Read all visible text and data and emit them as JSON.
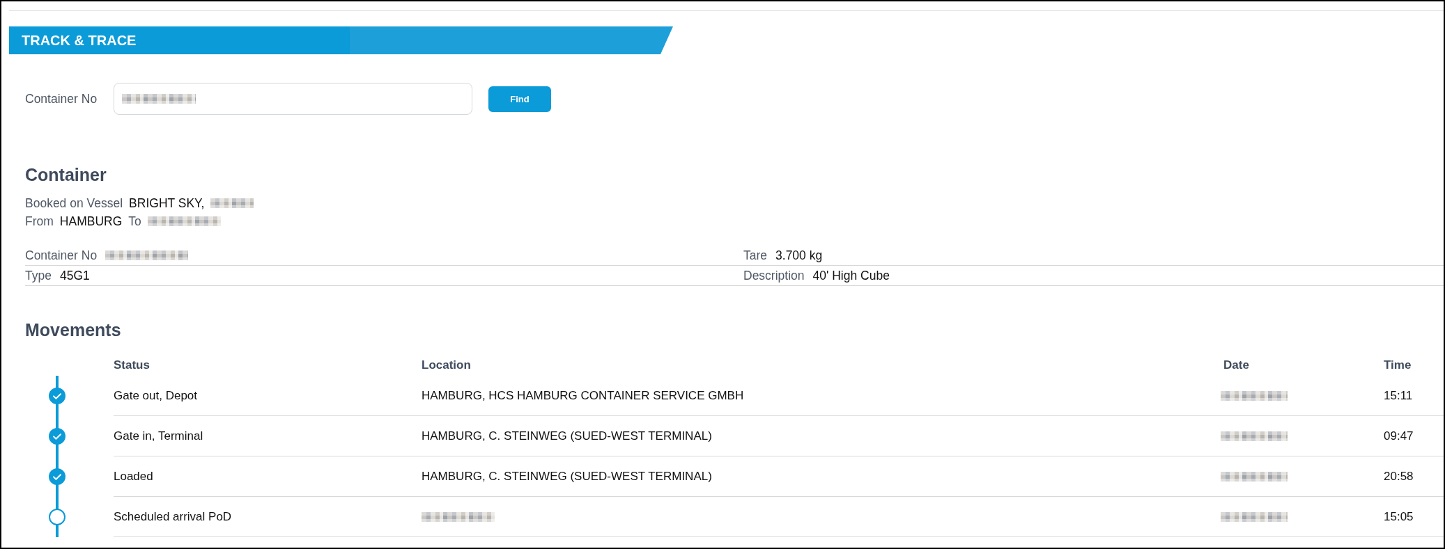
{
  "banner": {
    "title": "TRACK & TRACE"
  },
  "search": {
    "label": "Container No",
    "value_redacted": true,
    "button": "Find"
  },
  "container": {
    "heading": "Container",
    "lines": [
      {
        "fields": [
          {
            "label": "Booked on Vessel",
            "value": "BRIGHT SKY,",
            "redacted": true
          }
        ]
      },
      {
        "fields": [
          {
            "label": "From",
            "value": "HAMBURG",
            "redacted": false
          },
          {
            "label": "To",
            "redacted": true
          }
        ]
      }
    ],
    "details": [
      {
        "label": "Container No",
        "redacted": true
      },
      {
        "label": "Tare",
        "value": "3.700 kg",
        "redacted": false
      },
      {
        "label": "Type",
        "value": "45G1",
        "redacted": false
      },
      {
        "label": "Description",
        "value": "40' High Cube",
        "redacted": false
      }
    ]
  },
  "movements": {
    "heading": "Movements",
    "columns": [
      "Status",
      "Location",
      "Date",
      "Time"
    ],
    "rows": [
      {
        "done": true,
        "status": "Gate out, Depot",
        "location": "HAMBURG, HCS HAMBURG CONTAINER SERVICE GMBH",
        "location_redacted": false,
        "date_redacted": true,
        "time": "15:11"
      },
      {
        "done": true,
        "status": "Gate in, Terminal",
        "location": "HAMBURG, C. STEINWEG (SUED-WEST TERMINAL)",
        "location_redacted": false,
        "date_redacted": true,
        "time": "09:47"
      },
      {
        "done": true,
        "status": "Loaded",
        "location": "HAMBURG, C. STEINWEG (SUED-WEST TERMINAL)",
        "location_redacted": false,
        "date_redacted": true,
        "time": "20:58"
      },
      {
        "done": false,
        "status": "Scheduled arrival PoD",
        "location_redacted": true,
        "date_redacted": true,
        "time": "15:05"
      }
    ]
  }
}
